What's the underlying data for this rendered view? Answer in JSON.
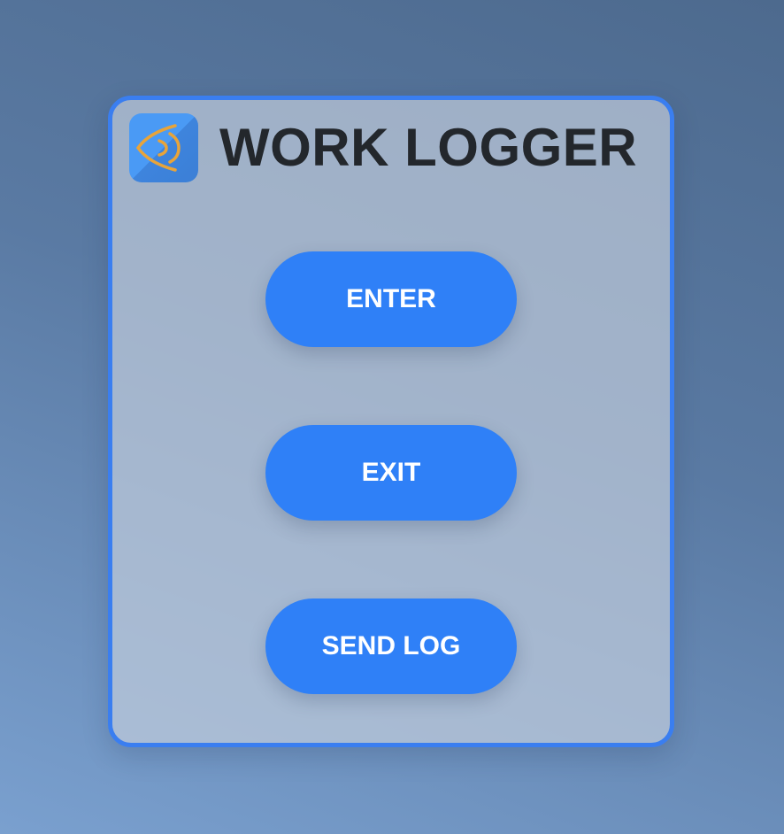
{
  "app": {
    "title": "WORK LOGGER",
    "icon": "eye-logo-icon"
  },
  "buttons": {
    "enter": "ENTER",
    "exit": "EXIT",
    "send_log": "SEND LOG"
  },
  "colors": {
    "accent": "#2f80f7",
    "panel_border": "#3a7ef0",
    "logo_stroke": "#e8a43a",
    "title_text": "#23272c"
  }
}
